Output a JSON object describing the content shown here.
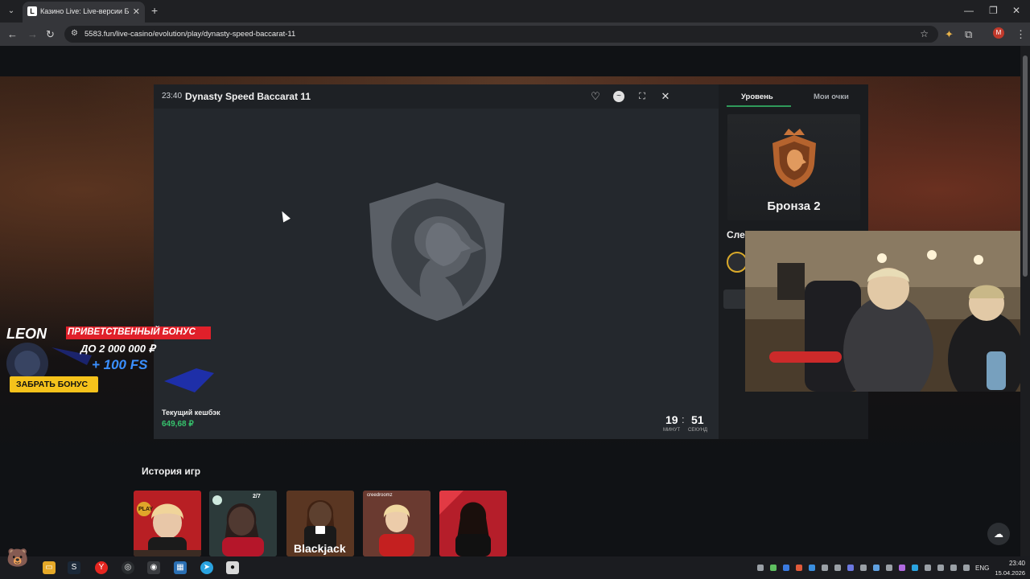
{
  "browser": {
    "tab_title": "Казино Live: Live-версии Блэкдж",
    "url": "5583.fun/live-casino/evolution/play/dynasty-speed-baccarat-11",
    "profile_initial": "M"
  },
  "player": {
    "time": "23:40",
    "title": "Dynasty Speed Baccarat 11",
    "cashback_label": "Текущий кешбэк",
    "cashback_value": "649,68 ₽",
    "timer_minutes": "19",
    "timer_seconds": "51",
    "timer_minutes_label": "МИНУТ",
    "timer_seconds_label": "СЕКУНД"
  },
  "side_panel": {
    "tab_level": "Уровень",
    "tab_points": "Мои очки",
    "rank_name": "Бронза 2",
    "next_label": "Сле"
  },
  "promo": {
    "brand": "LEON",
    "headline": "ПРИВЕТСТВЕННЫЙ БОНУС",
    "amount": "ДО 2 000 000 ₽",
    "fs": "+ 100 FS",
    "cta": "ЗАБРАТЬ БОНУС"
  },
  "history": {
    "title": "История игр",
    "games": [
      {
        "label": "PLAY",
        "bg": "#b81f24"
      },
      {
        "label": "2/7",
        "bg": "#2a2f33"
      },
      {
        "label": "Blackjack",
        "bg": "#4a2a1c"
      },
      {
        "label": "creedroomz",
        "bg": "#5a2a28"
      },
      {
        "label": "",
        "bg": "#b51e2a"
      }
    ]
  },
  "taskbar": {
    "lang": "ENG",
    "time": "23:40",
    "date": "15.04.2026"
  },
  "colors": {
    "accent_green": "#36c26c",
    "tab_underline": "#2f9a5a",
    "promo_red": "#e0202a",
    "promo_yellow": "#f5c21b"
  }
}
